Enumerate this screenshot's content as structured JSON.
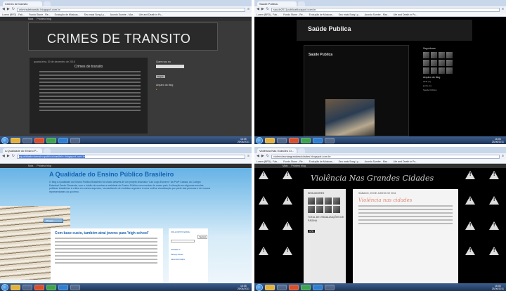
{
  "panels": [
    {
      "tab": "Crimes de transito",
      "url": "crimesdetransito.blogspot.com.br",
      "bookmarks": [
        "Lorem (BR3) - Fab...",
        "Fundo Stone - Re...",
        "Evolução de Músicas...",
        "Seu mais Song Ly...",
        "Acordo Sumbe - Mar...",
        "Life and Death in Pu...",
        "4ª Milagres - Lugares...",
        "BudiarBlog - Conte..."
      ],
      "blogger_bar": [
        "Mais",
        "Próximo blog"
      ],
      "blog_title": "CRIMES DE TRANSITO",
      "post_date": "quarta-feira, 30 de dezembro de 2015",
      "post_title": "Crimes de transito",
      "sidebar": [
        "Quem sou eu",
        "Arquivo do blog"
      ],
      "side_button": "Seguir"
    },
    {
      "tab": "Saude Publica",
      "url": "saude2011publicabloqspot.com.br",
      "bookmarks": [
        "Lorem (BR3) - Fab...",
        "Fundo Stone - Re...",
        "Evolução de Músicas...",
        "Seu mais Song Ly...",
        "Acordo Sumbe - Mar...",
        "Life and Death in Pu...",
        "4ª Milagres - Lugares...",
        "BudiarBlog - Conte..."
      ],
      "blogger_bar": [
        "Mais",
        "Próximo blog"
      ],
      "blog_title": "Saúde Publica",
      "post_title": "Saúde Publica",
      "sidebar": [
        "Seguidores",
        "Arquivo do blog"
      ],
      "archive": [
        "2011 (1)",
        "junho (1)",
        "Saúde Publica"
      ]
    },
    {
      "tab": "A Qualidade do Ensino P...",
      "url": "aqualidadedoensinopublicobrasileiro.blogspot.com.br",
      "blogger_bar": [
        "Mais",
        "Próximo blog"
      ],
      "blog_title": "A Qualidade do Ensino Público Brasileiro",
      "blog_description": "O blog A Qualidade do Ensino Público Brasileiro foi criado através de um projeto chamado \"Lan Logo Escrevo\" da Profª Cassia, do Colégio Estadual Santa Clemente, com o intuito de mostrar a realidade do Ensino Público nas escolas de nosso país. A situação em algumas escolas públicas brasileiras é crítica em vários aspectos, necessitando de medidas urgentes. A uma melhor visualização por parte das pessoas e de nossos representantes do governo.",
      "follow_button": "Blogger",
      "post_title": "Com base custo, também atrai jovens para 'high school'",
      "sidebar": [
        "FOLLOW BY EMAIL",
        "SHARE IT",
        "PESQUISAR",
        "SEGUIDORES"
      ],
      "side_button": "Submit"
    },
    {
      "tab": "Violência Nas Grandes Ci...",
      "url": "violenciasnasgrandescidades.blogspot.com.br",
      "bookmarks": [
        "Lorem (BR3) - Fab...",
        "Fundo Stone - Re...",
        "Evolução de Músicas...",
        "Seu mais Song Ly...",
        "Acordo Sumbe - Mar...",
        "Life and Death in Pu...",
        "4ª Milagres - Lugares...",
        "BudiarBlog - Conte..."
      ],
      "blogger_bar": [
        "Mais",
        "Próximo blog"
      ],
      "blog_title": "Violência Nas Grandes Cidades",
      "followers_label": "SEGUIDORES",
      "views_label": "TOTAL DE VISUALIZAÇÕES DE PÁGINA",
      "views_value": "170",
      "post_date": "SÁBADO, 25 DE JUNHO DE 2011",
      "post_title": "Violência nas cidades"
    }
  ],
  "taskbar": {
    "time": "16:05",
    "date": "25/06/2011"
  }
}
